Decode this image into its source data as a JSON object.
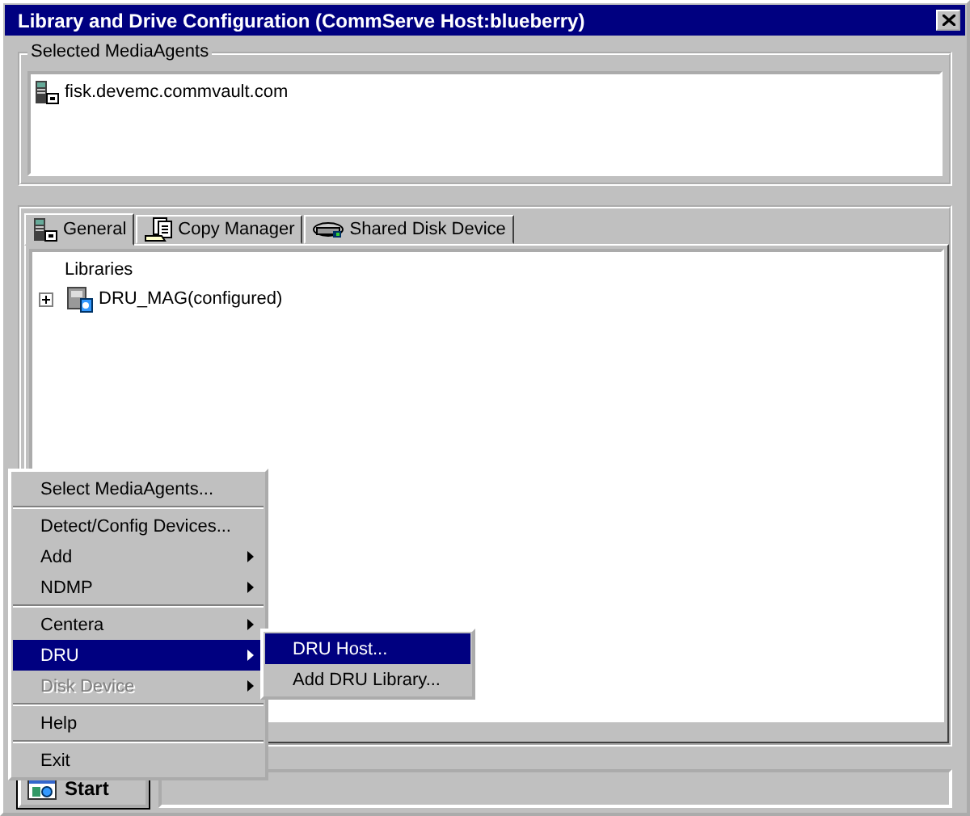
{
  "window": {
    "title": "Library and Drive Configuration (CommServe Host:blueberry)"
  },
  "media_agents": {
    "legend": "Selected MediaAgents",
    "items": [
      {
        "label": "fisk.devemc.commvault.com"
      }
    ]
  },
  "tabs": [
    {
      "label": "General",
      "kind": "server",
      "selected": true
    },
    {
      "label": "Copy Manager",
      "kind": "copy",
      "selected": false
    },
    {
      "label": "Shared Disk Device",
      "kind": "disk",
      "selected": false
    }
  ],
  "tree": {
    "header": "Libraries",
    "items": [
      {
        "label": "DRU_MAG(configured)",
        "expanded": false
      }
    ]
  },
  "start_menu": {
    "groups": [
      [
        {
          "label": "Select MediaAgents...",
          "submenu": false,
          "disabled": false,
          "selected": false
        }
      ],
      [
        {
          "label": "Detect/Config Devices...",
          "submenu": false,
          "disabled": false,
          "selected": false
        },
        {
          "label": "Add",
          "submenu": true,
          "disabled": false,
          "selected": false
        },
        {
          "label": "NDMP",
          "submenu": true,
          "disabled": false,
          "selected": false
        }
      ],
      [
        {
          "label": "Centera",
          "submenu": true,
          "disabled": false,
          "selected": false
        },
        {
          "label": "DRU",
          "submenu": true,
          "disabled": false,
          "selected": true
        },
        {
          "label": "Disk Device",
          "submenu": true,
          "disabled": true,
          "selected": false
        }
      ],
      [
        {
          "label": "Help",
          "submenu": false,
          "disabled": false,
          "selected": false
        }
      ],
      [
        {
          "label": "Exit",
          "submenu": false,
          "disabled": false,
          "selected": false
        }
      ]
    ]
  },
  "submenu": [
    {
      "label": "DRU Host...",
      "selected": true
    },
    {
      "label": "Add DRU Library...",
      "selected": false
    }
  ],
  "start_button": {
    "label": "Start"
  }
}
